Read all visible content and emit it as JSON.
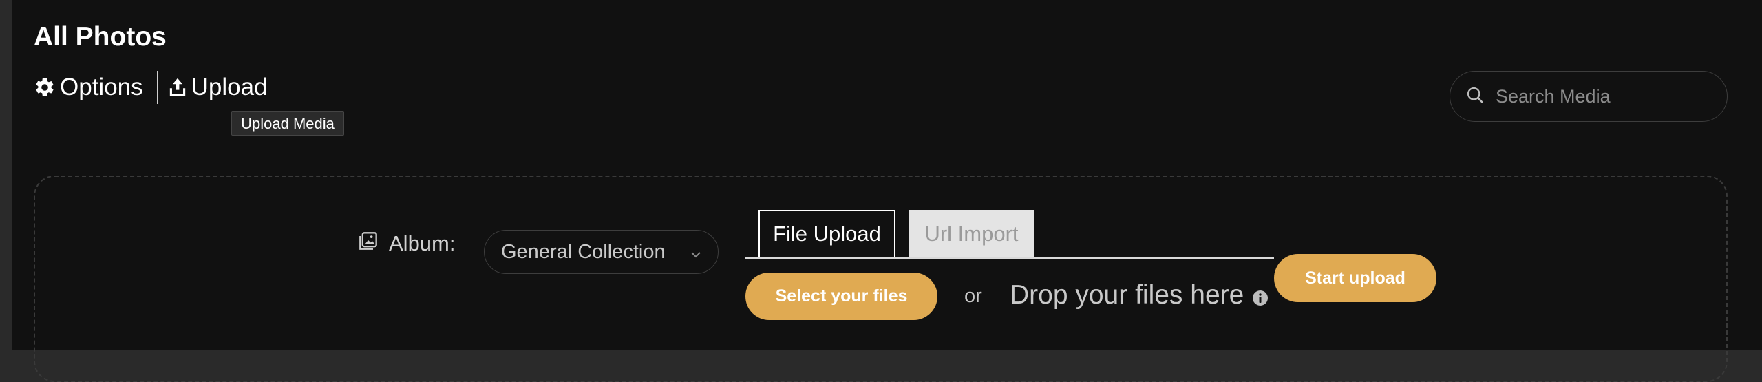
{
  "page": {
    "title": "All Photos"
  },
  "toolbar": {
    "options_label": "Options",
    "options_icon": "gear-icon",
    "upload_label": "Upload",
    "upload_icon": "upload-icon"
  },
  "tooltip": {
    "text": "Upload Media"
  },
  "search": {
    "placeholder": "Search Media",
    "value": "",
    "icon": "search-icon"
  },
  "uploader": {
    "album_label": "Album:",
    "album_icon": "album-icon",
    "album_selected": "General Collection",
    "tabs": [
      {
        "label": "File Upload",
        "active": true
      },
      {
        "label": "Url Import",
        "active": false
      }
    ],
    "select_files_label": "Select your files",
    "or_label": "or",
    "drop_label": "Drop your files here",
    "info_icon": "info-icon",
    "start_upload_label": "Start upload"
  },
  "colors": {
    "background": "#111111",
    "accent": "#e0aa52",
    "text": "#ffffff",
    "muted_text": "#c9c9c9"
  }
}
